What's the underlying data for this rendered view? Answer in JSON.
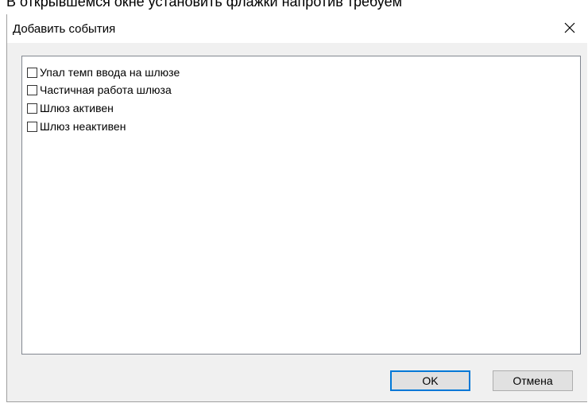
{
  "background_text": "В открывшемся окне установить флажки напротив требуем",
  "dialog": {
    "title": "Добавить события",
    "close_icon": "close-icon",
    "events": [
      {
        "label": "Упал темп ввода на шлюзе",
        "checked": false
      },
      {
        "label": "Частичная работа шлюза",
        "checked": false
      },
      {
        "label": "Шлюз активен",
        "checked": false
      },
      {
        "label": "Шлюз неактивен",
        "checked": false
      }
    ],
    "ok_label": "OK",
    "cancel_label": "Отмена"
  },
  "colors": {
    "dialog_bg": "#f0f0f0",
    "default_button_border": "#0078d7",
    "button_bg": "#e1e1e1"
  }
}
